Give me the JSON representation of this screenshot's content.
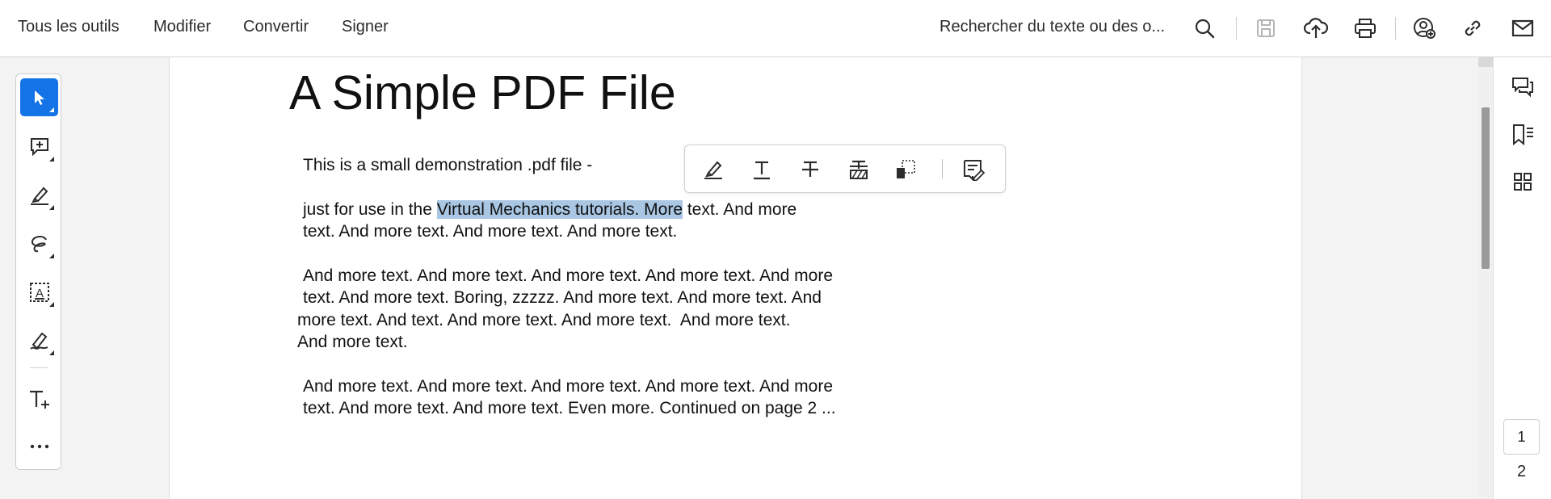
{
  "menu": {
    "all_tools": "Tous les outils",
    "edit": "Modifier",
    "convert": "Convertir",
    "sign": "Signer"
  },
  "search": {
    "label": "Rechercher du texte ou des o..."
  },
  "toolbar_icons": [
    "search-icon",
    "save-icon",
    "upload-cloud-icon",
    "print-icon",
    "share-user-icon",
    "link-icon",
    "mail-icon"
  ],
  "left_tools": [
    "select-pointer-icon",
    "add-comment-icon",
    "highlight-pen-icon",
    "draw-freeform-icon",
    "text-recognition-icon",
    "signature-pen-icon",
    "add-text-icon",
    "more-tools-icon"
  ],
  "float_toolbar": [
    "highlight-icon",
    "underline-icon",
    "strikethrough-icon",
    "replace-text-icon",
    "copy-icon",
    "comment-note-icon"
  ],
  "document": {
    "title": "A Simple PDF File",
    "line1": "This is a small demonstration .pdf file -",
    "line2_before": "just for use in the ",
    "line2_highlight": "Virtual Mechanics tutorials. More",
    "line2_after": " text. And more",
    "line3": "text. And more text. And more text. And more text.",
    "line4": "And more text. And more text. And more text. And more text. And more",
    "line5": "text. And more text. Boring, zzzzz. And more text. And more text. And",
    "line6": "more text. And text. And more text. And more text.  And more text.",
    "line7": "And more text.",
    "line8": "And more text. And more text. And more text. And more text. And more",
    "line9": "text. And more text. And more text. Even more. Continued on page 2 ..."
  },
  "right_rail_icons": [
    "comments-icon",
    "bookmarks-icon",
    "thumbnails-grid-icon"
  ],
  "pages": {
    "current": "1",
    "total": "2"
  },
  "colors": {
    "accent": "#1473e6",
    "highlight": "#a9c6e3"
  }
}
